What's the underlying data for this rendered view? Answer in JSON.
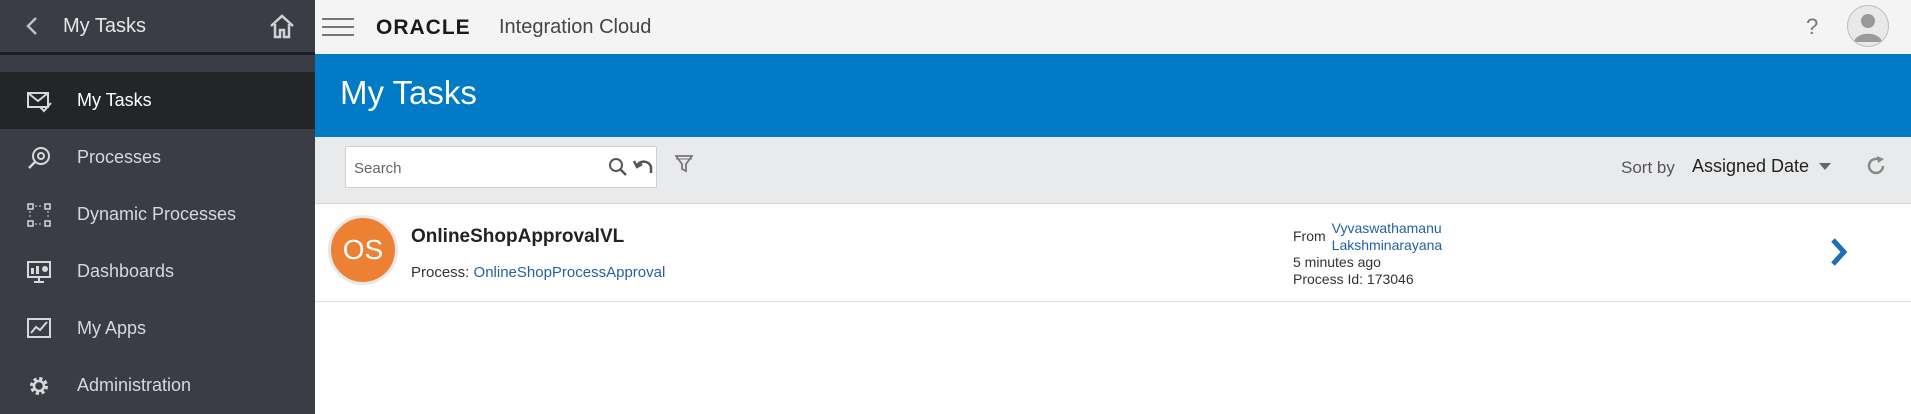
{
  "sidebar": {
    "title": "My Tasks",
    "items": [
      {
        "label": "My Tasks",
        "icon": "envelope-check-icon",
        "active": true
      },
      {
        "label": "Processes",
        "icon": "processes-icon",
        "active": false
      },
      {
        "label": "Dynamic Processes",
        "icon": "dynamic-processes-icon",
        "active": false
      },
      {
        "label": "Dashboards",
        "icon": "dashboard-icon",
        "active": false
      },
      {
        "label": "My Apps",
        "icon": "chart-icon",
        "active": false
      },
      {
        "label": "Administration",
        "icon": "gear-icon",
        "active": false
      }
    ]
  },
  "header": {
    "logo": "ORACLE",
    "product": "Integration Cloud",
    "help": "?"
  },
  "banner": {
    "title": "My Tasks"
  },
  "toolbar": {
    "search_placeholder": "Search",
    "sort_label": "Sort by",
    "sort_value": "Assigned Date"
  },
  "task": {
    "initials": "OS",
    "initials_color": "#ec8134",
    "title": "OnlineShopApprovalVL",
    "process_label": "Process:",
    "process_name": "OnlineShopProcessApproval",
    "from_label": "From",
    "assignee_first": "Vyvaswathamanu",
    "assignee_last": "Lakshminarayana",
    "time_ago": "5 minutes ago",
    "process_id_text": "Process Id: 173046"
  },
  "colors": {
    "sidebar_bg": "#3a3d46",
    "accent_blue": "#027bc7",
    "link": "#2361a5"
  }
}
